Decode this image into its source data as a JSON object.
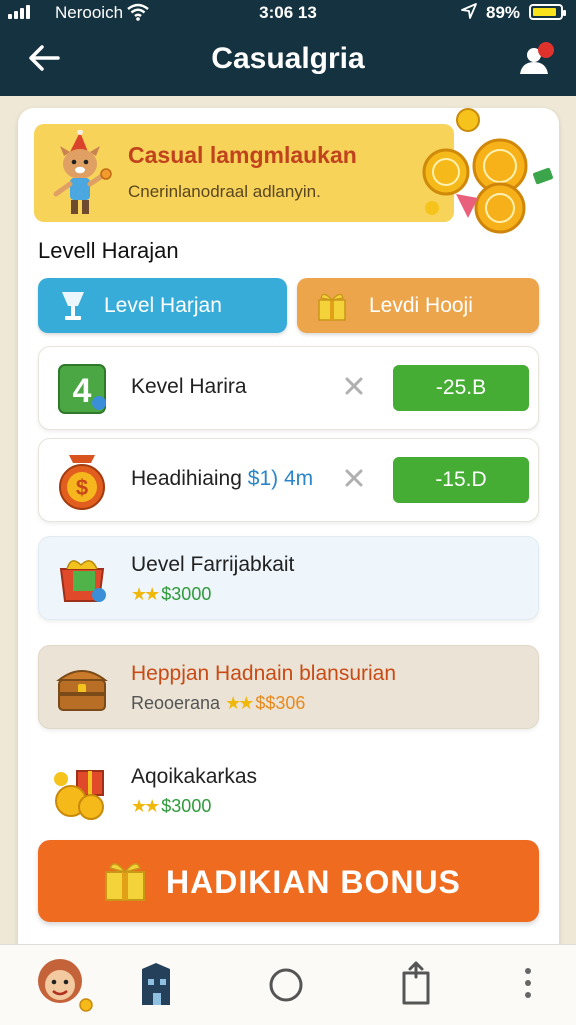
{
  "status_bar": {
    "carrier": "Nerooich",
    "time": "3:06 13",
    "battery": "89%",
    "battery_level": 0.89
  },
  "header": {
    "title": "Casualgria"
  },
  "banner": {
    "title": "Casual lamgmlaukan",
    "subtitle": "Cnerinlanodraal adlanyin."
  },
  "section": {
    "title": "Levell Harajan"
  },
  "tabs": [
    {
      "label": "Level Harjan",
      "icon": "trophy-cup-icon"
    },
    {
      "label": "Levdi Hooji",
      "icon": "gift-box-icon"
    }
  ],
  "rows": [
    {
      "label": "Kevel Harira",
      "amount": "-25.B",
      "icon": "green-block-icon"
    },
    {
      "label": "Headihiaing",
      "label_accent": "$1) 4m",
      "amount": "-15.D",
      "icon": "money-bag-icon"
    },
    {
      "title": "Uevel Farrijabkait",
      "stars": "★★",
      "value": "$3000",
      "icon": "gift-basket-icon"
    },
    {
      "title": "Heppjan Hadnain blansurian",
      "subtitle": "Reooerana",
      "stars": "★★",
      "value": "$$306",
      "icon": "treasure-chest-icon"
    },
    {
      "title": "Aqoikakarkas",
      "stars": "★★",
      "value": "$3000",
      "icon": "coins-gift-icon"
    }
  ],
  "bonus_button": {
    "label": "HADIKIAN BONUS"
  },
  "colors": {
    "header_bg": "#14323f",
    "accent_orange": "#ef6b1f",
    "accent_blue": "#38acd9",
    "accent_green": "#45ad34",
    "banner_yellow": "#f7d35a"
  }
}
